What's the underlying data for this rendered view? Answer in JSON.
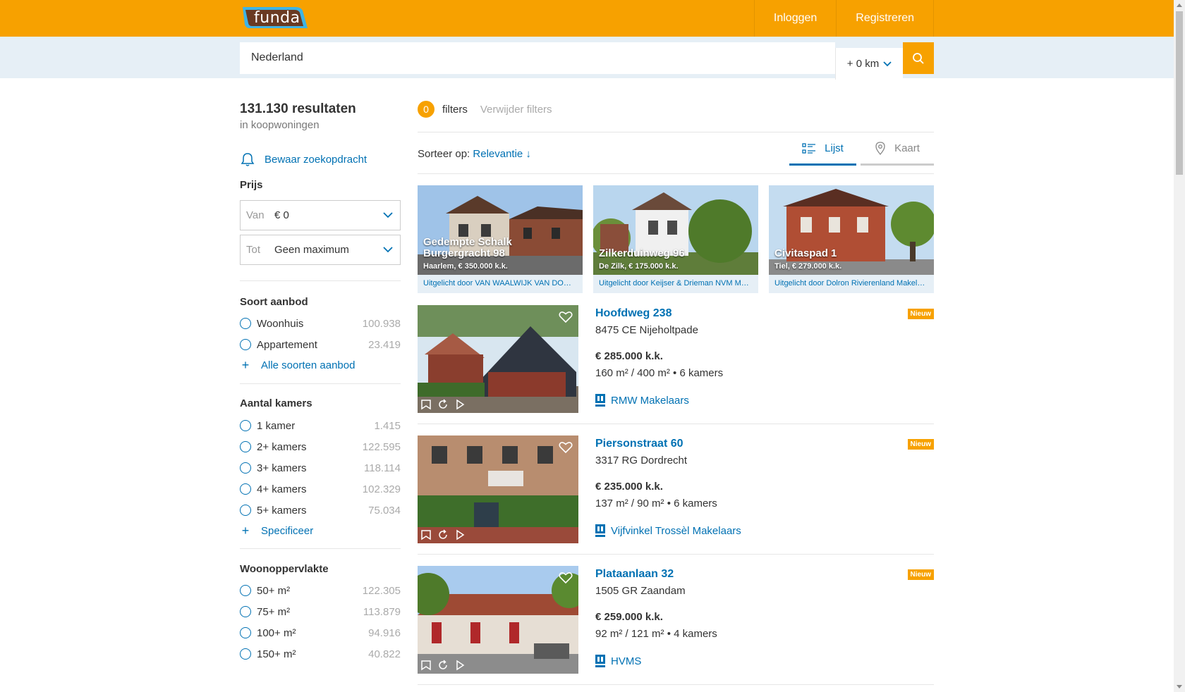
{
  "header": {
    "logo_text": "funda",
    "nav": [
      "Inloggen",
      "Registreren"
    ]
  },
  "search": {
    "value": "Nederland",
    "radius": "+ 0 km"
  },
  "sidebar": {
    "results_count": "131.130 resultaten",
    "results_sub": "in koopwoningen",
    "save_search": "Bewaar zoekopdracht",
    "price": {
      "title": "Prijs",
      "from_label": "Van",
      "from_value": "€ 0",
      "to_label": "Tot",
      "to_value": "Geen maximum"
    },
    "offer_type": {
      "title": "Soort aanbod",
      "options": [
        {
          "label": "Woonhuis",
          "count": "100.938"
        },
        {
          "label": "Appartement",
          "count": "23.419"
        }
      ],
      "more": "Alle soorten aanbod"
    },
    "rooms": {
      "title": "Aantal kamers",
      "options": [
        {
          "label": "1 kamer",
          "count": "1.415"
        },
        {
          "label": "2+ kamers",
          "count": "122.595"
        },
        {
          "label": "3+ kamers",
          "count": "118.114"
        },
        {
          "label": "4+ kamers",
          "count": "102.329"
        },
        {
          "label": "5+ kamers",
          "count": "75.034"
        }
      ],
      "more": "Specificeer"
    },
    "living_area": {
      "title": "Woonoppervlakte",
      "options": [
        {
          "label": "50+ m²",
          "count": "122.305"
        },
        {
          "label": "75+ m²",
          "count": "113.879"
        },
        {
          "label": "100+ m²",
          "count": "94.916"
        },
        {
          "label": "150+ m²",
          "count": "40.822"
        }
      ]
    }
  },
  "toolbar": {
    "filter_count": "0",
    "filters_label": "filters",
    "remove_filters": "Verwijder filters",
    "sort_label": "Sorteer op:",
    "sort_value": "Relevantie ↓",
    "view_list": "Lijst",
    "view_map": "Kaart"
  },
  "featured": [
    {
      "title": "Gedempte Schalk Burgergracht 98",
      "sub": "Haarlem, € 350.000 k.k.",
      "footer": "Uitgelicht door VAN WAALWIJK VAN DOORN"
    },
    {
      "title": "Zilkerduinweg 96",
      "sub": "De Zilk, € 175.000 k.k.",
      "footer": "Uitgelicht door Keijser & Drieman NVM Makelaars"
    },
    {
      "title": "Civitaspad 1",
      "sub": "Tiel, € 279.000 k.k.",
      "footer": "Uitgelicht door Dolron Rivierenland Makelaars"
    }
  ],
  "listings": [
    {
      "title": "Hoofdweg 238",
      "address": "8475 CE Nijeholtpade",
      "price": "€ 285.000 k.k.",
      "specs": "160 m² / 400 m² • 6 kamers",
      "agent": "RMW Makelaars",
      "badge": "Nieuw"
    },
    {
      "title": "Piersonstraat 60",
      "address": "3317 RG Dordrecht",
      "price": "€ 235.000 k.k.",
      "specs": "137 m² / 90 m² • 6 kamers",
      "agent": "Vijfvinkel Trossèl Makelaars",
      "badge": "Nieuw"
    },
    {
      "title": "Plataanlaan 32",
      "address": "1505 GR Zaandam",
      "price": "€ 259.000 k.k.",
      "specs": "92 m² / 121 m² • 4 kamers",
      "agent": "HVMS",
      "badge": "Nieuw"
    }
  ],
  "colors": {
    "brand_orange": "#f7a100",
    "link_blue": "#0071b3",
    "search_band": "#e6eff6"
  },
  "icons": [
    "search-icon",
    "chevron-down-icon",
    "bell-icon",
    "list-icon",
    "map-pin-icon",
    "heart-icon",
    "bookmark-icon",
    "rotate-icon",
    "play-icon",
    "nvm-logo-icon"
  ]
}
